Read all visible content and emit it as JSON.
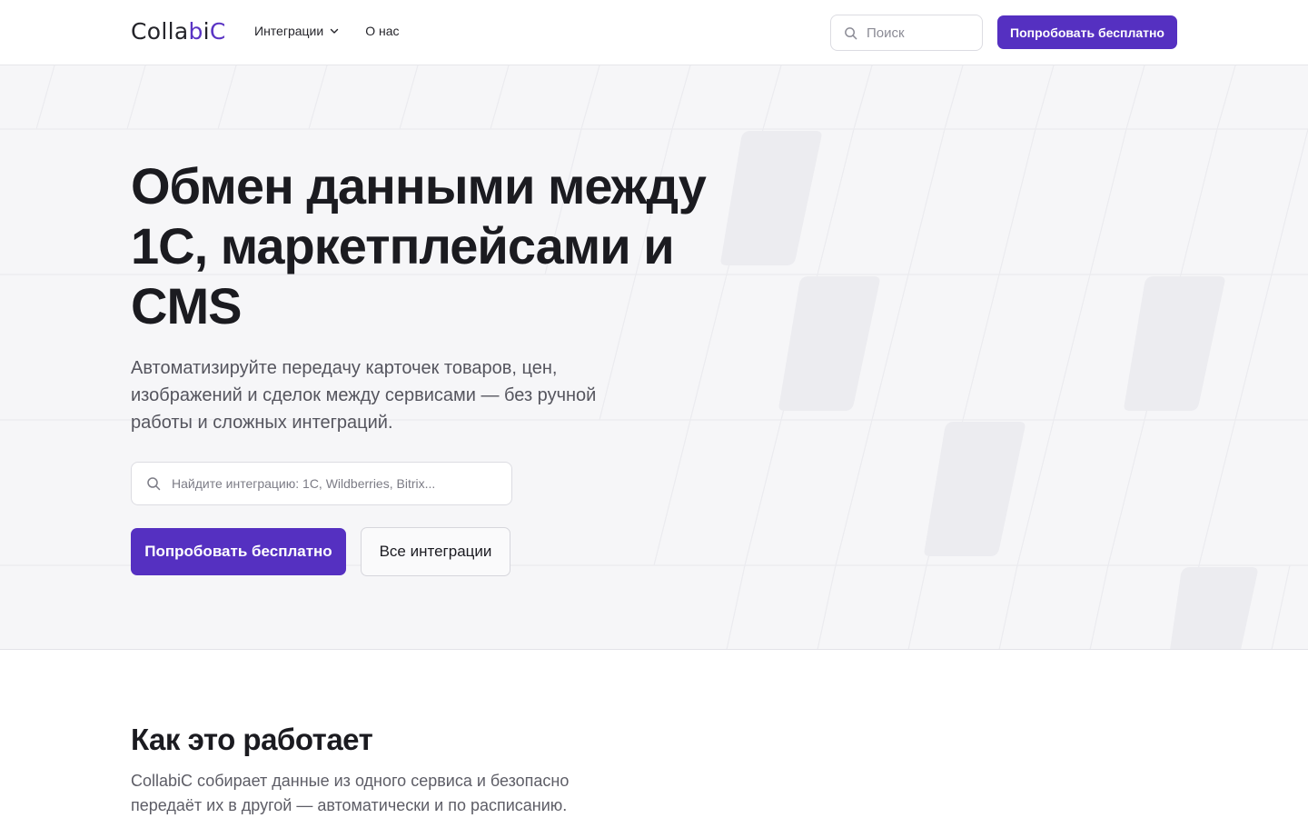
{
  "header": {
    "logo": {
      "part1": "Colla",
      "part2": "b",
      "part3": "i",
      "part4": "C"
    },
    "nav": [
      {
        "label": "Интеграции",
        "has_dropdown": true
      },
      {
        "label": "О нас",
        "has_dropdown": false
      }
    ],
    "search": {
      "placeholder": "Поиск",
      "value": ""
    },
    "cta_label": "Попробовать бесплатно"
  },
  "hero": {
    "title_lines": [
      "Обмен данными между",
      "1С, маркетплейсами и",
      "CMS"
    ],
    "subtitle": "Автоматизируйте передачу карточек товаров, цен, изображений и сделок между сервисами — без ручной работы и сложных интеграций.",
    "search": {
      "placeholder": "Найдите интеграцию: 1С, Wildberries, Bitrix...",
      "value": ""
    },
    "primary_button": "Попробовать бесплатно",
    "secondary_button": "Все интеграции"
  },
  "how": {
    "title": "Как это работает",
    "text": "CollabiC собирает данные из одного сервиса и безопасно передаёт их в другой — автоматически и по расписанию."
  },
  "colors": {
    "accent": "#5530c1",
    "hero_bg": "#f6f6f8",
    "text": "#1b1b20",
    "muted": "#55555e"
  },
  "icons": {
    "search": "search-icon",
    "chevron": "chevron-down-icon"
  }
}
